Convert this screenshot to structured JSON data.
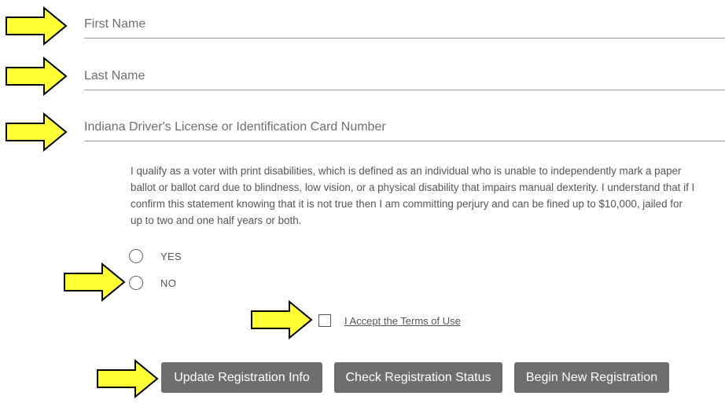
{
  "form": {
    "first_name": {
      "placeholder": "First Name",
      "value": ""
    },
    "last_name": {
      "placeholder": "Last Name",
      "value": ""
    },
    "license": {
      "placeholder": "Indiana Driver's License or Identification Card Number",
      "value": ""
    },
    "statement": "I qualify as a voter with print disabilities, which is defined as an individual who is unable to independently mark a paper ballot or ballot card due to blindness, low vision, or a physical disability that impairs manual dexterity. I understand that if I confirm this statement knowing that it is not true then I am committing perjury and can be fined up to $10,000, jailed for up to two and one half years or both.",
    "options": {
      "yes": "YES",
      "no": "NO"
    },
    "terms_label": "I Accept the Terms of Use"
  },
  "buttons": {
    "update": "Update Registration Info",
    "check": "Check Registration Status",
    "begin": "Begin New Registration"
  },
  "colors": {
    "arrow_fill": "#ffff33",
    "arrow_stroke": "#000000",
    "button_bg": "#6e6e6e"
  },
  "icons": {
    "annotation": "arrow-right-icon"
  }
}
